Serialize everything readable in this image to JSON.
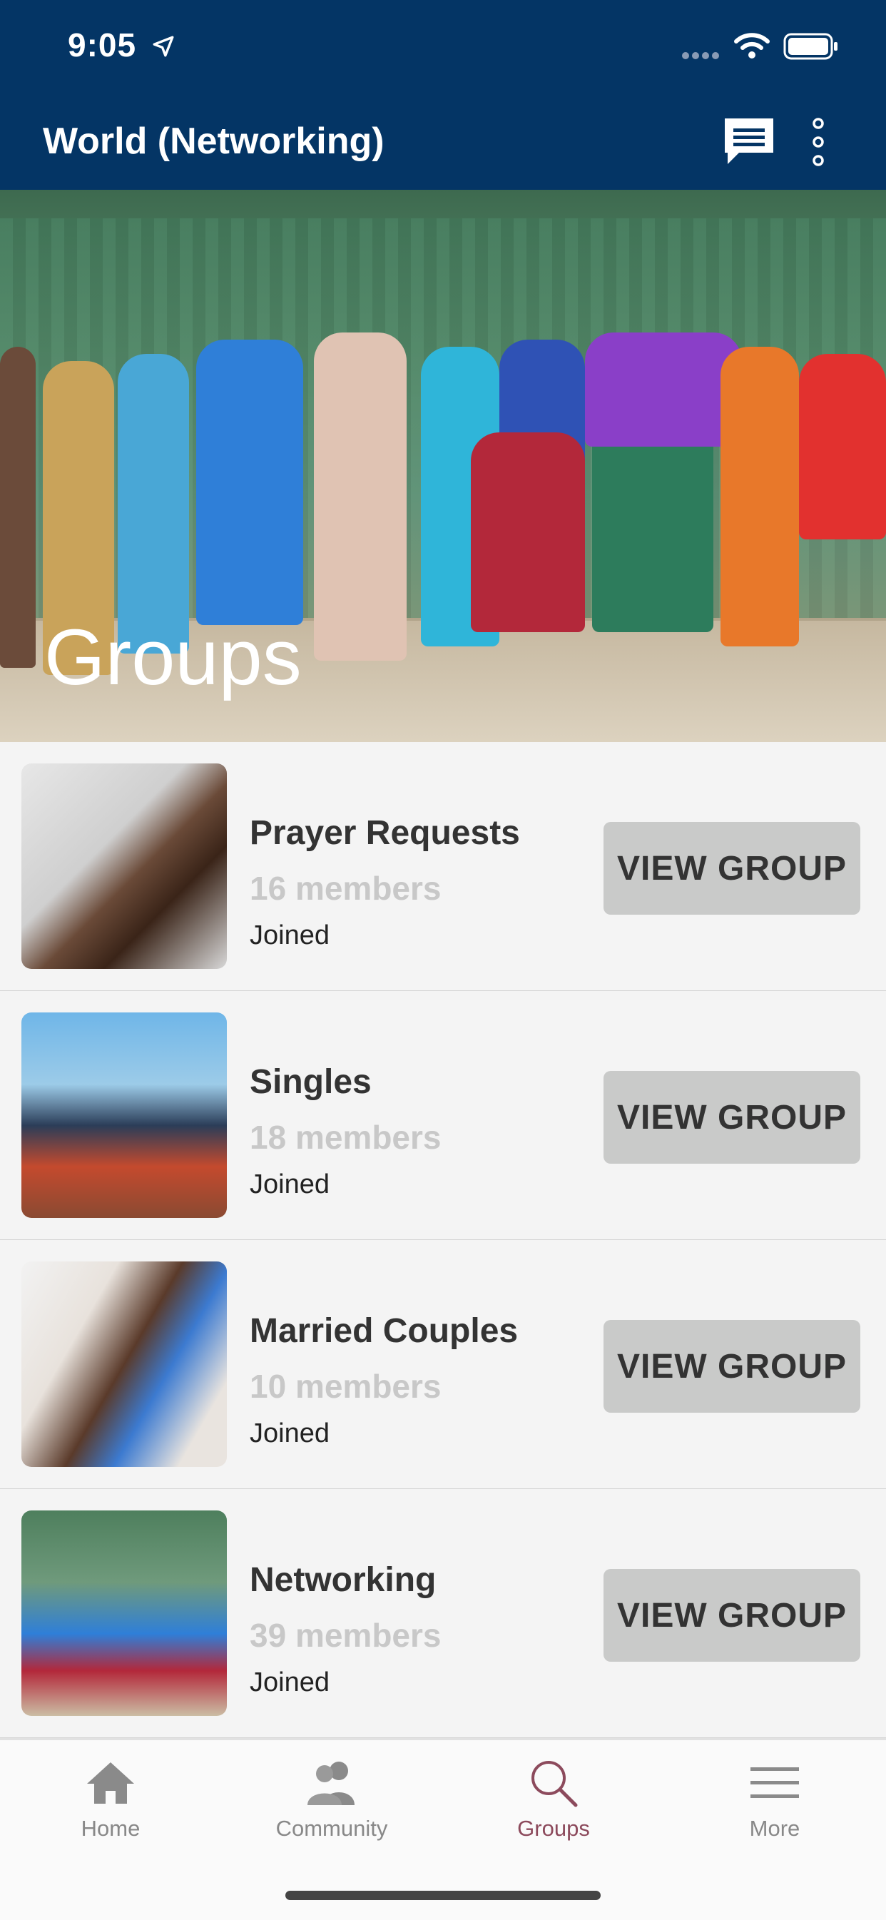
{
  "status_bar": {
    "time": "9:05"
  },
  "app_bar": {
    "title": "World (Networking)"
  },
  "hero": {
    "title": "Groups"
  },
  "groups": [
    {
      "name": "Prayer Requests",
      "members": "16 members",
      "status": "Joined",
      "button": "VIEW GROUP"
    },
    {
      "name": "Singles",
      "members": "18 members",
      "status": "Joined",
      "button": "VIEW GROUP"
    },
    {
      "name": "Married Couples",
      "members": "10 members",
      "status": "Joined",
      "button": "VIEW GROUP"
    },
    {
      "name": "Networking",
      "members": "39 members",
      "status": "Joined",
      "button": "VIEW GROUP"
    }
  ],
  "tabs": [
    {
      "label": "Home",
      "icon": "home-icon"
    },
    {
      "label": "Community",
      "icon": "community-icon"
    },
    {
      "label": "Groups",
      "icon": "search-icon",
      "active": true
    },
    {
      "label": "More",
      "icon": "menu-icon"
    }
  ],
  "colors": {
    "header": "#043565",
    "active_tab": "#8c4a5c",
    "button": "#c9cac9"
  }
}
